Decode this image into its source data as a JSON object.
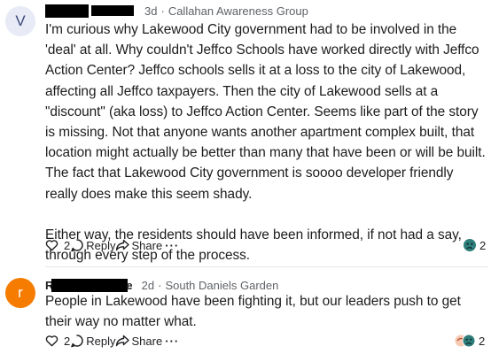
{
  "comments": [
    {
      "avatar_letter": "V",
      "avatar_bg": "#e8eaf6",
      "avatar_fg": "#3c4a7a",
      "time": "3d",
      "separator": "·",
      "group": "Callahan Awareness Group",
      "paragraphs": [
        "I'm curious why Lakewood City government had to be involved in the 'deal' at all. Why couldn't Jeffco Schools have worked directly with Jeffco Action Center?  Jeffco schools sells it at a loss to the city of Lakewood, affecting all Jeffco taxpayers. Then the city of Lakewood sells at a \"discount\" (aka loss) to Jeffco Action Center. Seems like part of the story is missing. Not that anyone wants another apartment complex built, that location might actually be better than many that have been or will be built. The fact that Lakewood City government is soooo developer friendly really does make this seem shady.",
        "Either way, the residents should have been informed, if not had a say, through every step of the process."
      ],
      "like_count": "2",
      "reply_label": "Reply",
      "share_label": "Share",
      "more_label": "···",
      "reaction_icon": "sad-face-reaction-icon",
      "reaction_count": "2"
    },
    {
      "avatar_letter": "r",
      "avatar_bg": "#f57c00",
      "avatar_fg": "#ffffff",
      "name_visible_prefix": "R",
      "name_visible_suffix": "e",
      "time": "2d",
      "separator": "·",
      "group": "South Daniels Garden",
      "paragraphs": [
        "People in Lakewood have been fighting it, but our leaders push to get their way no matter what."
      ],
      "like_count": "2",
      "reply_label": "Reply",
      "share_label": "Share",
      "more_label": "···",
      "reaction_icon": "mixed-reactions-icon",
      "reaction_count": "2"
    }
  ]
}
